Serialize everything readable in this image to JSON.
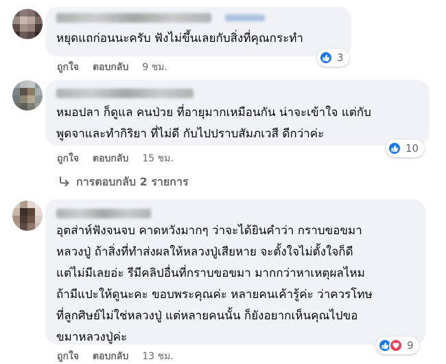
{
  "colors": {
    "bubble": "#f0f2f5",
    "like": "#1877f2",
    "love": "#f33e58",
    "meta": "#65676b"
  },
  "comments": [
    {
      "text_lines": [
        "หยุดแถก่อนนะครับ ฟังไม่ขึ้นเลยกับสิ่งที่คุณกระทำ"
      ],
      "reactions": {
        "icons": [
          "like-icon"
        ],
        "count": "3"
      },
      "actions": {
        "like": "ถูกใจ",
        "reply": "ตอบกลับ",
        "time": "9 ชม."
      }
    },
    {
      "text_lines": [
        "หมอปลา ก็ดูแล คนป่วย ที่อายุมากเหมือนกัน น่าจะเข้าใจ แต่กับ",
        "พูดจาและทำกิริยา ที่ไม่ดี กับไปปราบสัมภเวสี ดีกว่าค่ะ"
      ],
      "reactions": {
        "icons": [
          "like-icon"
        ],
        "count": "10"
      },
      "actions": {
        "like": "ถูกใจ",
        "reply": "ตอบกลับ",
        "time": "15 ชม."
      },
      "replies_link": "การตอบกลับ 2 รายการ",
      "replies_icon": "reply-arrow-icon"
    },
    {
      "text_lines": [
        "อุตส่าห์ฟังจนจบ คาดหวังมากๆ ว่าจะได้ยินคำว่า กราบขอขมา",
        "หลวงปู่ ถ้าสิ่งที่ทำส่งผลให้หลวงปู่เสียหาย จะตั้งใจไม่ตั้งใจก็ดี",
        "แต่ไม่มีเลยอ่ะ รีมีคลิปอื่นที่กราบขอขมา มากกว่าหาเหตุผลไหม",
        "ถ้ามีแปะให้ดูนะคะ ขอบพระคุณค่ะ หลายคนเค้ารู้ค่ะ ว่าควรโทษ",
        "ที่ลูกศิษย์ไม่ใช่หลวงปู่ แต่หลายคนนั้น ก็ยังอยากเห็นคุณไปขอ",
        "ขมาหลวงปู่ค่ะ"
      ],
      "reactions": {
        "icons": [
          "like-icon",
          "love-icon"
        ],
        "count": "9"
      },
      "actions": {
        "like": "ถูกใจ",
        "reply": "ตอบกลับ",
        "time": "13 ชม."
      }
    }
  ]
}
